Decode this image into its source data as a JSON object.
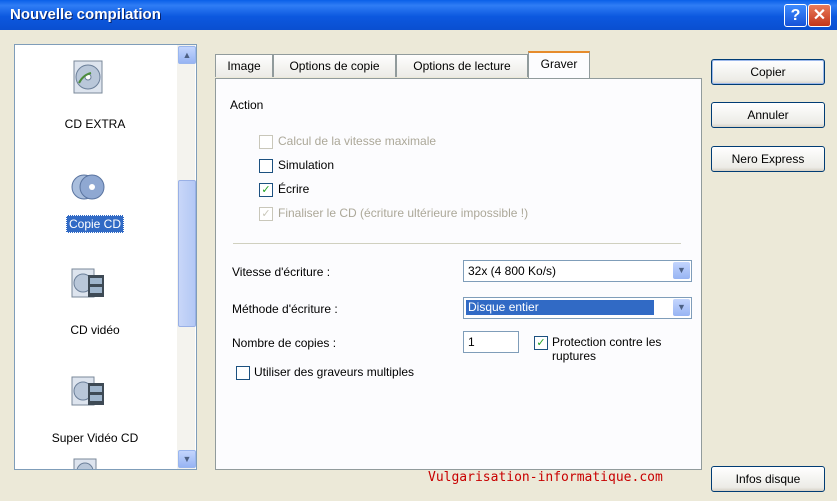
{
  "window": {
    "title": "Nouvelle compilation",
    "help_label": "?",
    "close_label": "✕"
  },
  "sidebar": {
    "items": [
      {
        "label": "CD EXTRA",
        "icon": "cd-extra-icon"
      },
      {
        "label": "Copie CD",
        "icon": "copy-cd-icon",
        "selected": true
      },
      {
        "label": "CD vidéo",
        "icon": "video-cd-icon"
      },
      {
        "label": "Super Vidéo CD",
        "icon": "super-video-cd-icon"
      }
    ],
    "scroll_up": "▲",
    "scroll_down": "▼"
  },
  "tabs": [
    {
      "label": "Image"
    },
    {
      "label": "Options de copie"
    },
    {
      "label": "Options de lecture"
    },
    {
      "label": "Graver",
      "active": true
    }
  ],
  "burn": {
    "section_title": "Action",
    "checks": {
      "max_speed": {
        "label": "Calcul de la vitesse maximale",
        "checked": false,
        "disabled": true
      },
      "simulation": {
        "label": "Simulation",
        "checked": false,
        "disabled": false
      },
      "write": {
        "label": "Écrire",
        "checked": true,
        "disabled": false
      },
      "finalize": {
        "label": "Finaliser le CD (écriture ultérieure impossible !)",
        "checked": true,
        "disabled": true
      }
    },
    "speed_label": "Vitesse d'écriture :",
    "speed_value": "32x (4 800 Ko/s)",
    "method_label": "Méthode d'écriture :",
    "method_value": "Disque entier",
    "copies_label": "Nombre de copies :",
    "copies_value": "1",
    "protection_label": "Protection contre les ruptures",
    "multi_label": "Utiliser des graveurs multiples",
    "check_mark": "✓"
  },
  "buttons": {
    "copy": "Copier",
    "cancel": "Annuler",
    "nero_express": "Nero Express",
    "disc_info": "Infos disque"
  },
  "watermark": "Vulgarisation-informatique.com",
  "colors": {
    "title_bar": "#0A5FE8",
    "selection": "#316AC5",
    "tab_highlight": "#E68B2C"
  }
}
